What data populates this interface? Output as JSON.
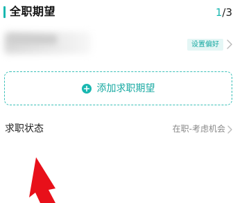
{
  "section": {
    "title": "全职期望",
    "counter_current": "1",
    "counter_sep": "/",
    "counter_total": "3"
  },
  "preference": {
    "tag_label": "设置偏好",
    "chevron_icon": "chevron-right-icon"
  },
  "add_button": {
    "icon": "plus-circle-icon",
    "label": "添加求职期望"
  },
  "job_status": {
    "label": "求职状态",
    "value": "在职-考虑机会",
    "chevron_icon": "chevron-right-icon"
  },
  "colors": {
    "accent": "#18b7b0",
    "tag_bg": "#e4f6f5",
    "annotation_arrow": "#e8101a"
  }
}
